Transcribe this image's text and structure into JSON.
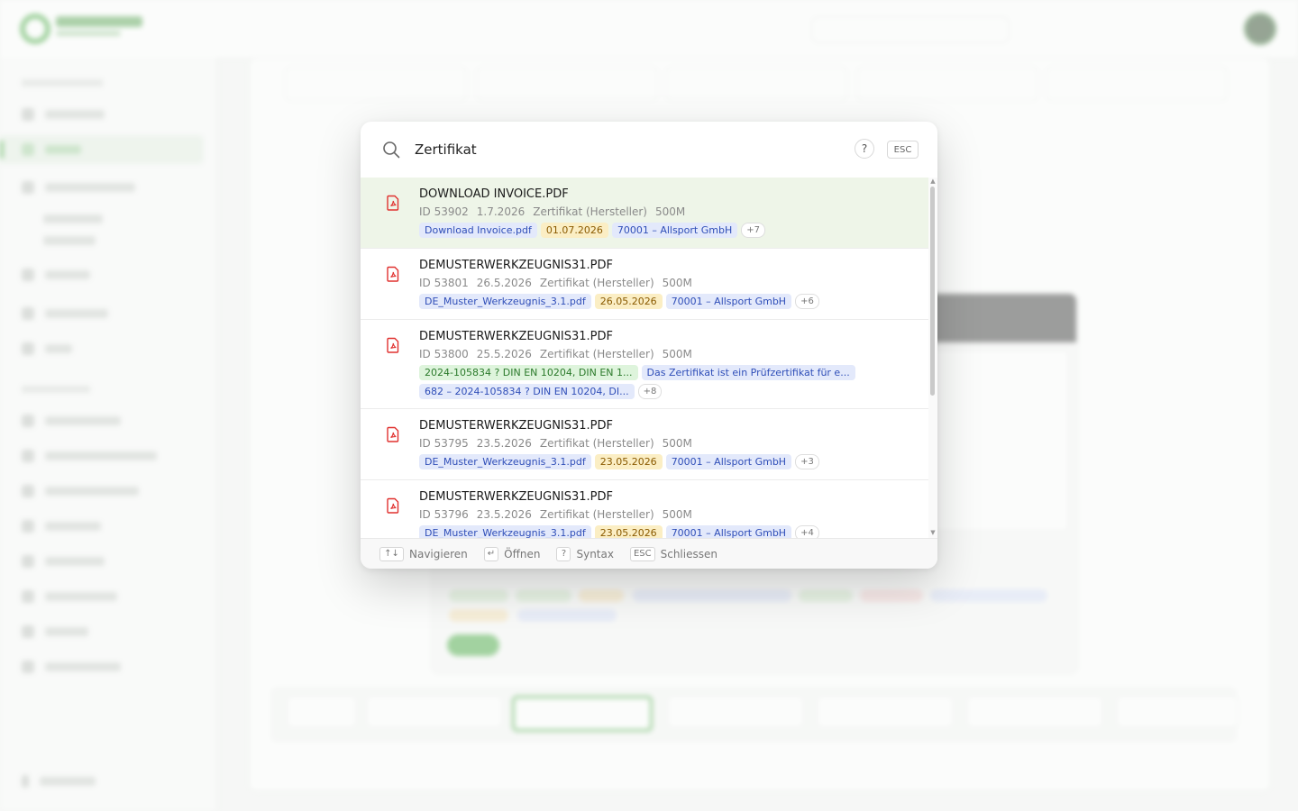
{
  "palette": {
    "query": "Zertifikat",
    "help_label": "?",
    "esc_label": "ESC",
    "results": [
      {
        "title": "DOWNLOAD INVOICE.PDF",
        "id": "ID 53902",
        "date": "1.7.2026",
        "type": "Zertifikat (Hersteller)",
        "size": "500M",
        "tags": [
          {
            "text": "Download Invoice.pdf",
            "color": "blue"
          },
          {
            "text": "01.07.2026",
            "color": "yellow"
          },
          {
            "text": "70001 – Allsport GmbH",
            "color": "blue"
          }
        ],
        "more": "+7",
        "active": true
      },
      {
        "title": "DEMUSTERWERKZEUGNIS31.PDF",
        "id": "ID 53801",
        "date": "26.5.2026",
        "type": "Zertifikat (Hersteller)",
        "size": "500M",
        "tags": [
          {
            "text": "DE_Muster_Werkzeugnis_3.1.pdf",
            "color": "blue"
          },
          {
            "text": "26.05.2026",
            "color": "yellow"
          },
          {
            "text": "70001 – Allsport GmbH",
            "color": "blue"
          }
        ],
        "more": "+6",
        "active": false
      },
      {
        "title": "DEMUSTERWERKZEUGNIS31.PDF",
        "id": "ID 53800",
        "date": "25.5.2026",
        "type": "Zertifikat (Hersteller)",
        "size": "500M",
        "tags": [
          {
            "text": "2024-105834 ? DIN EN 10204, DIN EN 1...",
            "color": "green"
          },
          {
            "text": "Das Zertifikat ist ein Prüfzertifikat für e...",
            "color": "blue"
          },
          {
            "text": "682 – 2024-105834 ? DIN EN 10204, DI...",
            "color": "blue"
          }
        ],
        "more": "+8",
        "active": false
      },
      {
        "title": "DEMUSTERWERKZEUGNIS31.PDF",
        "id": "ID 53795",
        "date": "23.5.2026",
        "type": "Zertifikat (Hersteller)",
        "size": "500M",
        "tags": [
          {
            "text": "DE_Muster_Werkzeugnis_3.1.pdf",
            "color": "blue"
          },
          {
            "text": "23.05.2026",
            "color": "yellow"
          },
          {
            "text": "70001 – Allsport GmbH",
            "color": "blue"
          }
        ],
        "more": "+3",
        "active": false
      },
      {
        "title": "DEMUSTERWERKZEUGNIS31.PDF",
        "id": "ID 53796",
        "date": "23.5.2026",
        "type": "Zertifikat (Hersteller)",
        "size": "500M",
        "tags": [
          {
            "text": "DE_Muster_Werkzeugnis_3.1.pdf",
            "color": "blue"
          },
          {
            "text": "23.05.2026",
            "color": "yellow"
          },
          {
            "text": "70001 – Allsport GmbH",
            "color": "blue"
          }
        ],
        "more": "+4",
        "active": false
      }
    ],
    "footer": {
      "nav_key": "↑↓",
      "nav_label": "Navigieren",
      "open_key": "↵",
      "open_label": "Öffnen",
      "syntax_key": "?",
      "syntax_label": "Syntax",
      "close_key": "ESC",
      "close_label": "Schliessen"
    }
  },
  "colors": {
    "accent": "#3aa335",
    "active_row": "#eef5e8",
    "pdf_icon": "#e0312f"
  },
  "icons": {
    "search": "search-icon",
    "file": "pdf-file-icon"
  }
}
